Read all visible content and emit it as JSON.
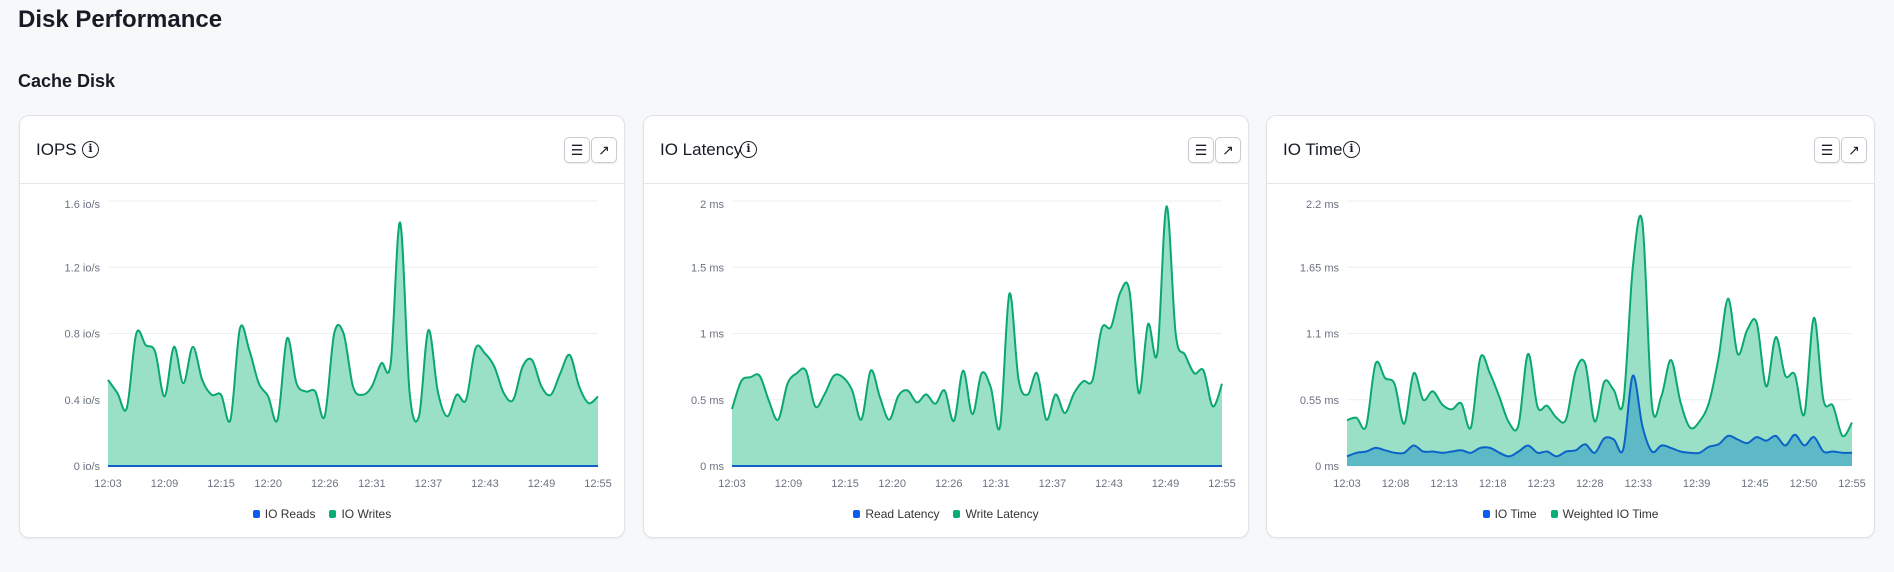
{
  "page": {
    "title": "Disk Performance",
    "section": "Cache Disk"
  },
  "colors": {
    "green_line": "#0aa86f",
    "green_fill": "#9ae0c7",
    "blue_line": "#0b63c9",
    "blue_fill": "#5bb6c6",
    "legend_blue": "#0d5cf0",
    "legend_green": "#0aae72"
  },
  "icons": {
    "info": "info-circle-icon",
    "menu": "hamburger-menu-icon",
    "expand": "arrow-up-right-icon"
  },
  "cards": [
    {
      "title": "IOPS",
      "info_glyph": "i",
      "menu_glyph": "☰",
      "expand_glyph": "↗",
      "legend": [
        "IO Reads",
        "IO Writes"
      ]
    },
    {
      "title": "IO Latency",
      "info_glyph": "i",
      "menu_glyph": "☰",
      "expand_glyph": "↗",
      "legend": [
        "Read Latency",
        "Write Latency"
      ]
    },
    {
      "title": "IO Time",
      "info_glyph": "i",
      "menu_glyph": "☰",
      "expand_glyph": "↗",
      "legend": [
        "IO Time",
        "Weighted IO Time"
      ]
    }
  ],
  "chart_data": [
    {
      "type": "area",
      "x_range": [
        "12:03",
        "12:55"
      ],
      "x_ticks": [
        "12:03",
        "12:09",
        "12:15",
        "12:20",
        "12:26",
        "12:31",
        "12:37",
        "12:43",
        "12:49",
        "12:55"
      ],
      "x_tick_minutes": [
        0,
        6,
        12,
        17,
        23,
        28,
        34,
        40,
        46,
        52
      ],
      "y_ticks": [
        "0 io/s",
        "0.4 io/s",
        "0.8 io/s",
        "1.2 io/s",
        "1.6 io/s"
      ],
      "ylim": [
        0,
        1.6
      ],
      "grid": true,
      "legend": "bottom",
      "series": [
        {
          "name": "IO Reads",
          "color": "blue",
          "values": [
            0,
            0,
            0,
            0,
            0,
            0,
            0,
            0,
            0,
            0,
            0,
            0,
            0,
            0,
            0,
            0,
            0,
            0,
            0,
            0,
            0,
            0,
            0,
            0,
            0,
            0,
            0,
            0,
            0,
            0,
            0,
            0,
            0,
            0,
            0,
            0,
            0,
            0,
            0,
            0,
            0,
            0,
            0,
            0,
            0,
            0,
            0,
            0,
            0,
            0,
            0,
            0,
            0
          ]
        },
        {
          "name": "IO Writes",
          "color": "green",
          "values": [
            0.52,
            0.44,
            0.35,
            0.8,
            0.73,
            0.69,
            0.42,
            0.72,
            0.5,
            0.72,
            0.52,
            0.43,
            0.43,
            0.28,
            0.83,
            0.7,
            0.5,
            0.42,
            0.28,
            0.77,
            0.5,
            0.45,
            0.45,
            0.3,
            0.8,
            0.8,
            0.48,
            0.43,
            0.48,
            0.62,
            0.62,
            1.47,
            0.45,
            0.3,
            0.82,
            0.45,
            0.3,
            0.43,
            0.4,
            0.71,
            0.68,
            0.6,
            0.44,
            0.4,
            0.6,
            0.64,
            0.48,
            0.43,
            0.56,
            0.67,
            0.48,
            0.38,
            0.42
          ]
        }
      ]
    },
    {
      "type": "area",
      "x_range": [
        "12:03",
        "12:55"
      ],
      "x_ticks": [
        "12:03",
        "12:09",
        "12:15",
        "12:20",
        "12:26",
        "12:31",
        "12:37",
        "12:43",
        "12:49",
        "12:55"
      ],
      "x_tick_minutes": [
        0,
        6,
        12,
        17,
        23,
        28,
        34,
        40,
        46,
        52
      ],
      "y_ticks": [
        "0 ms",
        "0.5 ms",
        "1 ms",
        "1.5 ms",
        "2 ms"
      ],
      "ylim": [
        0,
        2
      ],
      "grid": true,
      "legend": "bottom",
      "series": [
        {
          "name": "Read Latency",
          "color": "blue",
          "values": [
            0,
            0,
            0,
            0,
            0,
            0,
            0,
            0,
            0,
            0,
            0,
            0,
            0,
            0,
            0,
            0,
            0,
            0,
            0,
            0,
            0,
            0,
            0,
            0,
            0,
            0,
            0,
            0,
            0,
            0,
            0,
            0,
            0,
            0,
            0,
            0,
            0,
            0,
            0,
            0,
            0,
            0,
            0,
            0,
            0,
            0,
            0,
            0,
            0,
            0,
            0,
            0,
            0,
            0
          ]
        },
        {
          "name": "Write Latency",
          "color": "green",
          "values": [
            0.43,
            0.64,
            0.67,
            0.68,
            0.49,
            0.35,
            0.62,
            0.7,
            0.72,
            0.45,
            0.54,
            0.68,
            0.67,
            0.57,
            0.35,
            0.72,
            0.52,
            0.35,
            0.53,
            0.57,
            0.48,
            0.54,
            0.47,
            0.57,
            0.34,
            0.72,
            0.39,
            0.7,
            0.59,
            0.3,
            1.3,
            0.65,
            0.54,
            0.7,
            0.35,
            0.54,
            0.4,
            0.55,
            0.64,
            0.65,
            1.04,
            1.05,
            1.31,
            1.32,
            0.55,
            1.07,
            0.85,
            1.96,
            0.99,
            0.84,
            0.7,
            0.72,
            0.45,
            0.62
          ]
        }
      ]
    },
    {
      "type": "area",
      "x_range": [
        "12:03",
        "12:55"
      ],
      "x_ticks": [
        "12:03",
        "12:08",
        "12:13",
        "12:18",
        "12:23",
        "12:28",
        "12:33",
        "12:39",
        "12:45",
        "12:50",
        "12:55"
      ],
      "x_tick_minutes": [
        0,
        5,
        10,
        15,
        20,
        25,
        30,
        36,
        42,
        47,
        52
      ],
      "y_ticks": [
        "0 ms",
        "0.55 ms",
        "1.1 ms",
        "1.65 ms",
        "2.2 ms"
      ],
      "ylim": [
        0,
        2.2
      ],
      "grid": true,
      "legend": "bottom",
      "series": [
        {
          "name": "IO Time",
          "color": "blue",
          "values": [
            0.08,
            0.11,
            0.12,
            0.15,
            0.13,
            0.11,
            0.11,
            0.17,
            0.12,
            0.12,
            0.11,
            0.12,
            0.13,
            0.11,
            0.15,
            0.15,
            0.11,
            0.08,
            0.12,
            0.17,
            0.11,
            0.12,
            0.08,
            0.12,
            0.13,
            0.18,
            0.11,
            0.23,
            0.22,
            0.14,
            0.75,
            0.33,
            0.12,
            0.17,
            0.15,
            0.12,
            0.11,
            0.11,
            0.16,
            0.18,
            0.25,
            0.22,
            0.19,
            0.24,
            0.21,
            0.25,
            0.17,
            0.26,
            0.17,
            0.24,
            0.12,
            0.12,
            0.11,
            0.11
          ]
        },
        {
          "name": "Weighted IO Time",
          "color": "green",
          "values": [
            0.38,
            0.4,
            0.33,
            0.85,
            0.73,
            0.68,
            0.35,
            0.77,
            0.55,
            0.62,
            0.51,
            0.47,
            0.52,
            0.32,
            0.9,
            0.77,
            0.57,
            0.36,
            0.34,
            0.93,
            0.49,
            0.5,
            0.4,
            0.39,
            0.79,
            0.85,
            0.37,
            0.7,
            0.63,
            0.53,
            1.65,
            2.02,
            0.51,
            0.58,
            0.88,
            0.53,
            0.32,
            0.37,
            0.53,
            0.9,
            1.39,
            0.93,
            1.13,
            1.19,
            0.66,
            1.07,
            0.75,
            0.76,
            0.43,
            1.23,
            0.55,
            0.5,
            0.25,
            0.36
          ]
        }
      ]
    }
  ]
}
